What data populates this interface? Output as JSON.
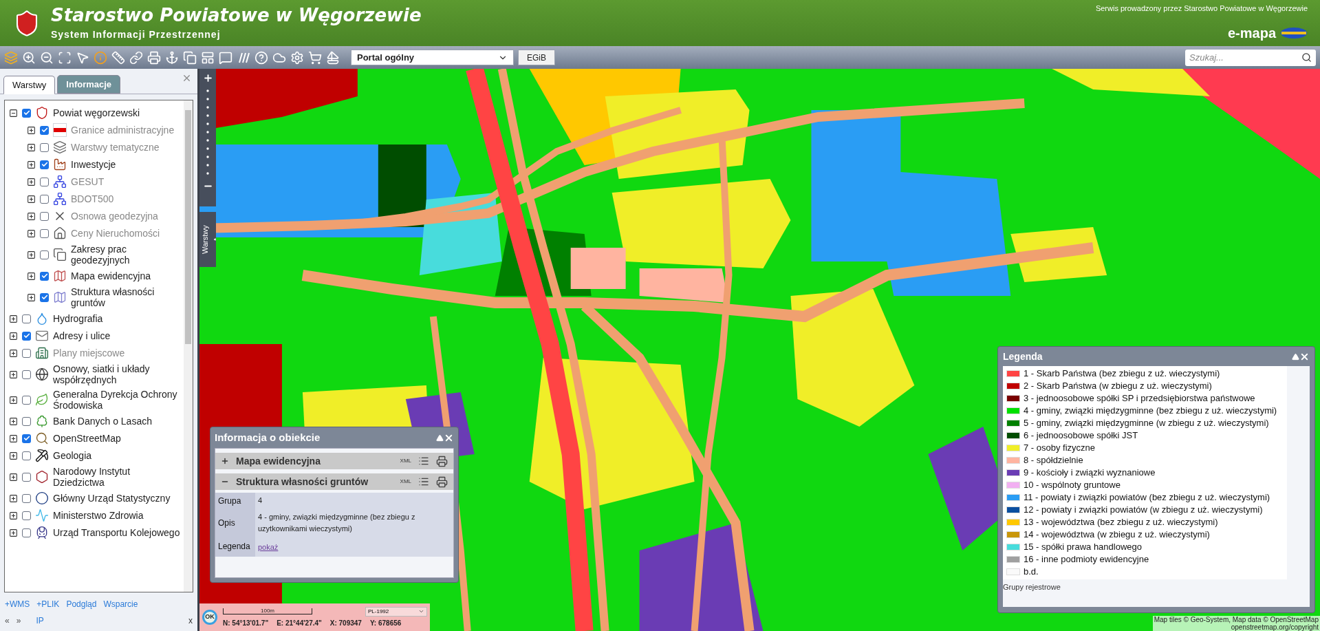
{
  "header": {
    "title": "Starostwo Powiatowe w Węgorzewie",
    "subtitle": "System Informacji Przestrzennej",
    "service_note": "Serwis prowadzony przez Starostwo Powiatowe w Węgorzewie",
    "brand": "e-mapa"
  },
  "toolbar": {
    "portal_select": "Portal ogólny",
    "egib_button": "EGiB",
    "search": {
      "placeholder": "Szukaj..."
    }
  },
  "side_panel": {
    "tabs": [
      {
        "label": "Warstwy",
        "selected": true
      },
      {
        "label": "Informacje",
        "selected": false
      }
    ],
    "layers": [
      {
        "label": "Powiat węgorzewski",
        "checked": true,
        "expanded": true,
        "greyed": false,
        "children": [
          {
            "label": "Granice administracyjne",
            "checked": true,
            "expanded": false,
            "greyed": true
          },
          {
            "label": "Warstwy tematyczne",
            "checked": false,
            "expanded": false,
            "greyed": true
          },
          {
            "label": "Inwestycje",
            "checked": true,
            "expanded": false,
            "greyed": false
          },
          {
            "label": "GESUT",
            "checked": false,
            "expanded": false,
            "greyed": true
          },
          {
            "label": "BDOT500",
            "checked": false,
            "expanded": false,
            "greyed": true
          },
          {
            "label": "Osnowa geodezyjna",
            "checked": false,
            "expanded": false,
            "greyed": true
          },
          {
            "label": "Ceny Nieruchomości",
            "checked": false,
            "expanded": false,
            "greyed": true
          },
          {
            "label": "Zakresy prac geodezyjnych",
            "checked": false,
            "expanded": false,
            "greyed": false
          },
          {
            "label": "Mapa ewidencyjna",
            "checked": true,
            "expanded": false,
            "greyed": false
          },
          {
            "label": "Struktura własności gruntów",
            "checked": true,
            "expanded": false,
            "greyed": false
          }
        ]
      },
      {
        "label": "Hydrografia",
        "checked": false,
        "expanded": false,
        "greyed": false
      },
      {
        "label": "Adresy i ulice",
        "checked": true,
        "expanded": false,
        "greyed": false
      },
      {
        "label": "Plany miejscowe",
        "checked": false,
        "expanded": false,
        "greyed": true
      },
      {
        "label": "Osnowy, siatki i układy współrzędnych",
        "checked": false,
        "expanded": false,
        "greyed": false
      },
      {
        "label": "Generalna Dyrekcja Ochrony Środowiska",
        "checked": false,
        "expanded": false,
        "greyed": false
      },
      {
        "label": "Bank Danych o Lasach",
        "checked": false,
        "expanded": false,
        "greyed": false
      },
      {
        "label": "OpenStreetMap",
        "checked": true,
        "expanded": false,
        "greyed": false
      },
      {
        "label": "Geologia",
        "checked": false,
        "expanded": false,
        "greyed": false
      },
      {
        "label": "Narodowy Instytut Dziedzictwa",
        "checked": false,
        "expanded": false,
        "greyed": false
      },
      {
        "label": "Główny Urząd Statystyczny",
        "checked": false,
        "expanded": false,
        "greyed": false
      },
      {
        "label": "Ministerstwo Zdrowia",
        "checked": false,
        "expanded": false,
        "greyed": false
      },
      {
        "label": "Urząd Transportu Kolejowego",
        "checked": false,
        "expanded": false,
        "greyed": false
      }
    ],
    "links": [
      "+WMS",
      "+PLIK",
      "Podgląd",
      "Wsparcie"
    ],
    "nav": [
      "«",
      "»"
    ],
    "ip": "IP",
    "close": "x"
  },
  "map": {
    "layers_tab": "Warstwy"
  },
  "info_popup": {
    "title": "Informacja o obiekcie",
    "sections": [
      {
        "label": "Mapa ewidencyjna",
        "expanded": false,
        "xml": "XML"
      },
      {
        "label": "Struktura własności gruntów",
        "expanded": true,
        "xml": "XML"
      }
    ],
    "rows": [
      {
        "label": "Grupa",
        "value": "4",
        "kind": "text"
      },
      {
        "label": "Opis",
        "value": "4 - gminy, związki międzygminne (bez zbiegu z uzytkownikami wieczystymi)",
        "kind": "text"
      },
      {
        "label": "Legenda",
        "value": "pokaż",
        "kind": "link"
      }
    ]
  },
  "legend": {
    "title": "Legenda",
    "items": [
      {
        "label": "1 - Skarb Państwa (bez zbiegu z uż. wieczystymi)",
        "color": "#ff4444"
      },
      {
        "label": "2 - Skarb Państwa (w zbiegu z uż. wieczystymi)",
        "color": "#c00000"
      },
      {
        "label": "3 - jednoosobowe spółki SP i przedsiębiorstwa państwowe",
        "color": "#7a0000"
      },
      {
        "label": "4 - gminy, związki międzygminne (bez zbiegu z uż. wieczystymi)",
        "color": "#00e000"
      },
      {
        "label": "5 - gminy, związki międzygminne (w zbiegu z uż. wieczystymi)",
        "color": "#008000"
      },
      {
        "label": "6 - jednoosobowe spółki JST",
        "color": "#004d00"
      },
      {
        "label": "7 - osoby fizyczne",
        "color": "#f0ee28"
      },
      {
        "label": "8 - spółdzielnie",
        "color": "#ffb4a0"
      },
      {
        "label": "9 - kościoły i związki wyznaniowe",
        "color": "#6a3cb4"
      },
      {
        "label": "10 - wspólnoty gruntowe",
        "color": "#f2b0f2"
      },
      {
        "label": "11 - powiaty i związki powiatów (bez zbiegu z uż. wieczystymi)",
        "color": "#2a9df4"
      },
      {
        "label": "12 - powiaty i związki powiatów (w zbiegu z uż. wieczystymi)",
        "color": "#0a4fa0"
      },
      {
        "label": "13 - województwa (bez zbiegu z uż. wieczystymi)",
        "color": "#ffc800"
      },
      {
        "label": "14 - województwa (w zbiegu z uż. wieczystymi)",
        "color": "#c8960a"
      },
      {
        "label": "15 - spółki prawa handlowego",
        "color": "#48dcdc"
      },
      {
        "label": "16 - inne podmioty ewidencyjne",
        "color": "#a0a0a0"
      },
      {
        "label": "b.d.",
        "color": "#fafafa"
      }
    ],
    "caption": "Grupy rejestrowe"
  },
  "status": {
    "ok": "OK",
    "scale": "100m",
    "crs": "PL-1992",
    "coords": [
      "N: 54°13'01.7\"",
      "E: 21°44'27.4\"",
      "X: 709347",
      "Y: 678656"
    ]
  },
  "attribution": [
    "Map tiles © Geo-System, Map data © OpenStreetMap",
    "openstreetmap.org/copyright"
  ]
}
